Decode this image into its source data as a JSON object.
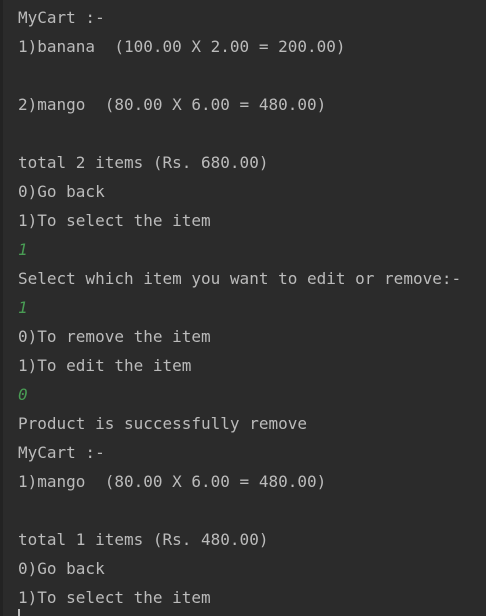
{
  "console": {
    "colors": {
      "background": "#2b2b2b",
      "output_text": "#bbbbbb",
      "user_input": "#499c54"
    },
    "lines": [
      {
        "text": "MyCart :-",
        "kind": "output"
      },
      {
        "text": "1)banana  (100.00 X 2.00 = 200.00)",
        "kind": "output"
      },
      {
        "text": "",
        "kind": "output"
      },
      {
        "text": "2)mango  (80.00 X 6.00 = 480.00)",
        "kind": "output"
      },
      {
        "text": "",
        "kind": "output"
      },
      {
        "text": "total 2 items (Rs. 680.00)",
        "kind": "output"
      },
      {
        "text": "0)Go back",
        "kind": "output"
      },
      {
        "text": "1)To select the item",
        "kind": "output"
      },
      {
        "text": "1",
        "kind": "input"
      },
      {
        "text": "Select which item you want to edit or remove:-",
        "kind": "output"
      },
      {
        "text": "1",
        "kind": "input"
      },
      {
        "text": "0)To remove the item",
        "kind": "output"
      },
      {
        "text": "1)To edit the item",
        "kind": "output"
      },
      {
        "text": "0",
        "kind": "input"
      },
      {
        "text": "Product is successfully remove",
        "kind": "output"
      },
      {
        "text": "MyCart :-",
        "kind": "output"
      },
      {
        "text": "1)mango  (80.00 X 6.00 = 480.00)",
        "kind": "output"
      },
      {
        "text": "",
        "kind": "output"
      },
      {
        "text": "total 1 items (Rs. 480.00)",
        "kind": "output"
      },
      {
        "text": "0)Go back",
        "kind": "output"
      },
      {
        "text": "1)To select the item",
        "kind": "output"
      }
    ]
  }
}
